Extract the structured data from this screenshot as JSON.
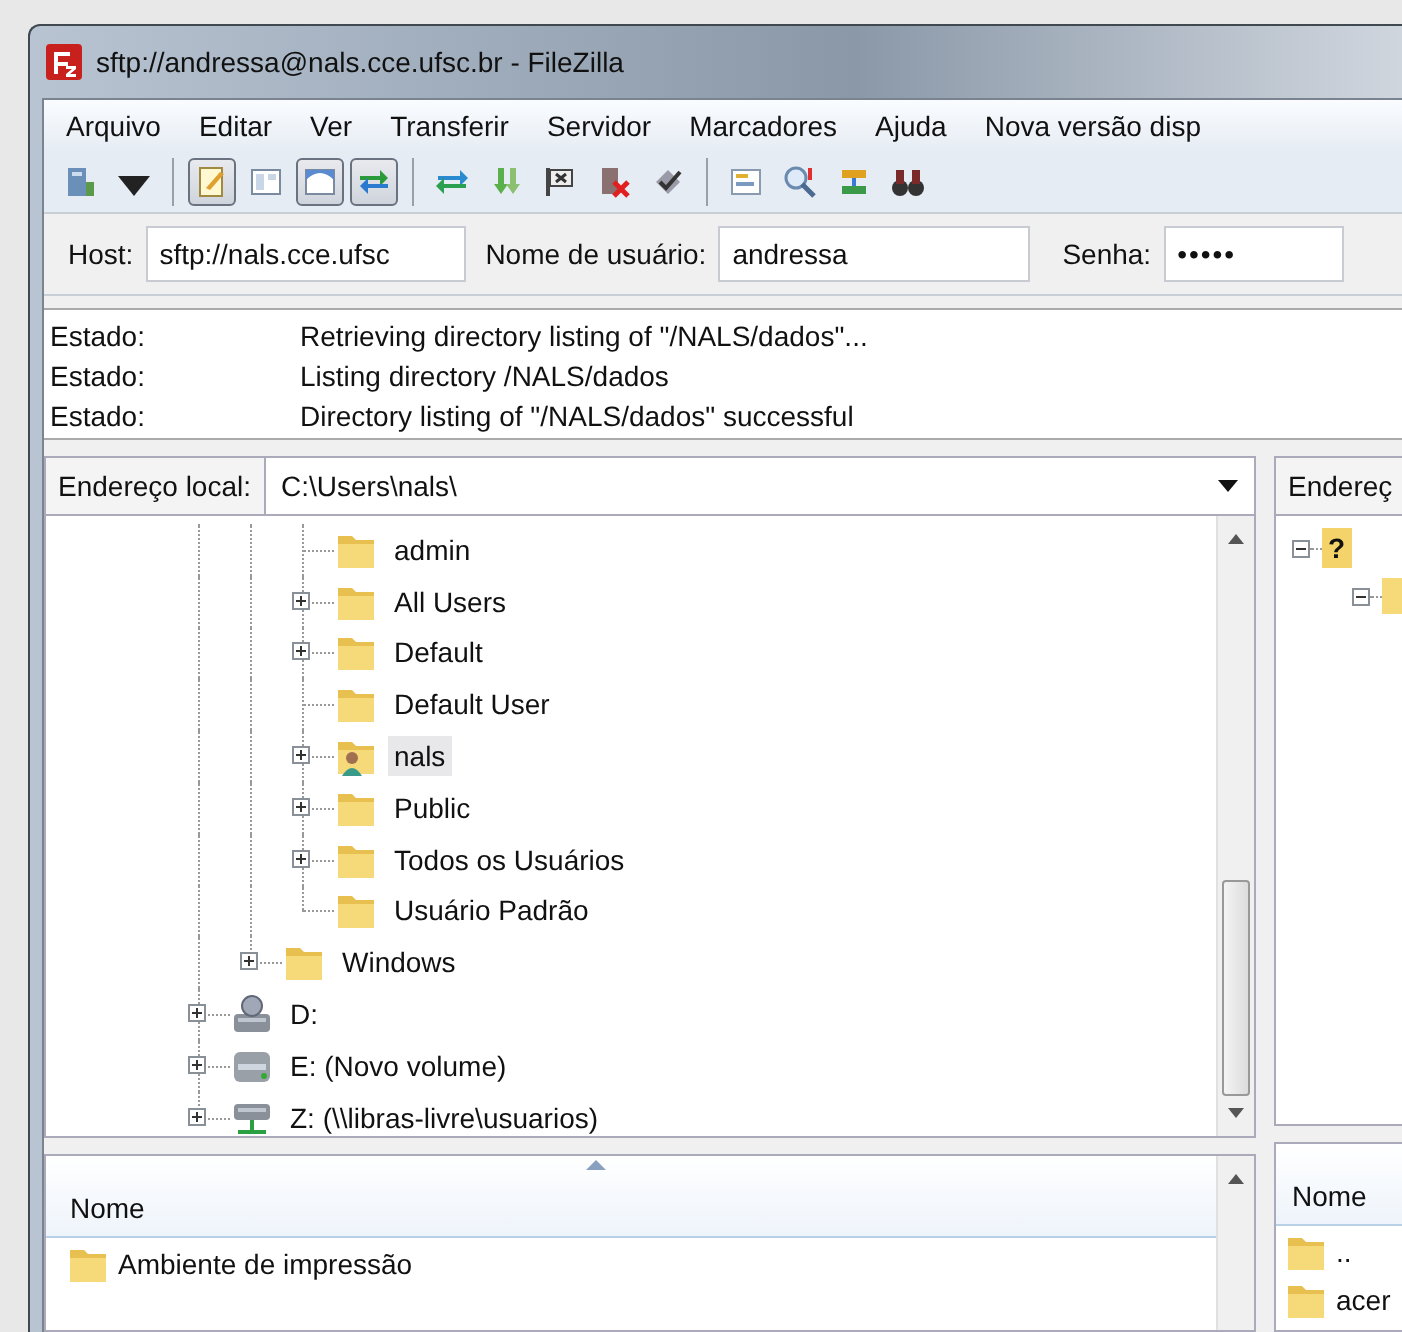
{
  "window": {
    "title": "sftp://andressa@nals.cce.ufsc.br - FileZilla"
  },
  "menu": [
    "Arquivo",
    "Editar",
    "Ver",
    "Transferir",
    "Servidor",
    "Marcadores",
    "Ajuda",
    "Nova versão disp"
  ],
  "toolbar": {
    "groups": [
      [
        {
          "kind": "server",
          "pressed": false
        },
        {
          "kind": "caret",
          "pressed": false
        }
      ],
      [
        {
          "kind": "notepad",
          "pressed": true
        },
        {
          "kind": "panel",
          "pressed": false
        },
        {
          "kind": "tree",
          "pressed": true
        },
        {
          "kind": "arrows",
          "pressed": true
        }
      ],
      [
        {
          "kind": "refresh",
          "pressed": false
        },
        {
          "kind": "download",
          "pressed": false
        },
        {
          "kind": "flag",
          "pressed": false
        },
        {
          "kind": "cancel",
          "pressed": false
        },
        {
          "kind": "check",
          "pressed": false
        }
      ],
      [
        {
          "kind": "filter",
          "pressed": false
        },
        {
          "kind": "magnifier",
          "pressed": false
        },
        {
          "kind": "sync",
          "pressed": false
        },
        {
          "kind": "binoculars",
          "pressed": false
        }
      ]
    ]
  },
  "quickconnect": {
    "host_label": "Host:",
    "host": "sftp://nals.cce.ufsc",
    "user_label": "Nome de usuário:",
    "user": "andressa",
    "password_label": "Senha:",
    "password": "•••••"
  },
  "log": [
    {
      "label": "Estado:",
      "message": "Retrieving directory listing of \"/NALS/dados\"..."
    },
    {
      "label": "Estado:",
      "message": "Listing directory /NALS/dados"
    },
    {
      "label": "Estado:",
      "message": "Directory listing of \"/NALS/dados\" successful"
    }
  ],
  "local": {
    "address_label": "Endereço local:",
    "address": "C:\\Users\\nals\\",
    "tree": [
      {
        "children": [
          {
            "children": [
              {
                "label": "admin",
                "kind": "folder",
                "expandable": false,
                "selected": false
              },
              {
                "label": "All Users",
                "kind": "folder",
                "expandable": true,
                "selected": false
              },
              {
                "label": "Default",
                "kind": "folder",
                "expandable": true,
                "selected": false
              },
              {
                "label": "Default User",
                "kind": "folder",
                "expandable": false,
                "selected": false
              },
              {
                "label": "nals",
                "kind": "user-folder",
                "expandable": true,
                "selected": true
              },
              {
                "label": "Public",
                "kind": "folder",
                "expandable": true,
                "selected": false
              },
              {
                "label": "Todos os Usuários",
                "kind": "folder",
                "expandable": true,
                "selected": false
              },
              {
                "label": "Usuário Padrão",
                "kind": "folder",
                "expandable": false,
                "selected": false
              }
            ]
          },
          {
            "label": "Windows",
            "kind": "folder",
            "expandable": true,
            "selected": false
          }
        ]
      },
      {
        "label": "D:",
        "kind": "drive",
        "expandable": true,
        "selected": false
      },
      {
        "label": "E: (Novo volume)",
        "kind": "removable",
        "expandable": true,
        "selected": false
      },
      {
        "label": "Z: (\\\\libras-livre\\usuarios)",
        "kind": "network",
        "expandable": true,
        "selected": false
      }
    ],
    "columns": [
      "Nome"
    ],
    "rows": [
      "Ambiente de impressão"
    ]
  },
  "remote": {
    "address_label": "Endereç",
    "tree": [
      {
        "glyph": "?",
        "expanded": true
      }
    ],
    "columns": [
      "Nome"
    ],
    "rows": [
      "..",
      "acer"
    ]
  }
}
